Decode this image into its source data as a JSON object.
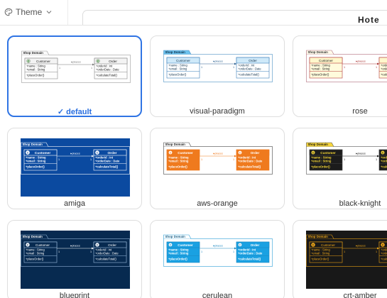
{
  "toolbar": {
    "theme_label": "Theme"
  },
  "tab": {
    "title": "Hote"
  },
  "themes": [
    {
      "name": "default",
      "selected": true
    },
    {
      "name": "visual-paradigm",
      "selected": false
    },
    {
      "name": "rose",
      "selected": false
    },
    {
      "name": "amiga",
      "selected": false
    },
    {
      "name": "aws-orange",
      "selected": false
    },
    {
      "name": "black-knight",
      "selected": false
    },
    {
      "name": "blueprint",
      "selected": false
    },
    {
      "name": "cerulean",
      "selected": false
    },
    {
      "name": "crt-amber",
      "selected": false
    }
  ],
  "diagram": {
    "package": "Shop Domain",
    "class1": {
      "name": "Customer",
      "fields": [
        "name : String",
        "email : String"
      ],
      "method": "placeOrder()"
    },
    "class2": {
      "name": "Order",
      "fields": [
        "orderId : int",
        "orderDate : Date"
      ],
      "method": "calculateTotal()"
    },
    "relation": "places",
    "multiplicity": "1"
  },
  "selected_mark": "✓",
  "colors": {
    "accent": "#2f74e4",
    "selected_label": "#2a6fe0"
  }
}
